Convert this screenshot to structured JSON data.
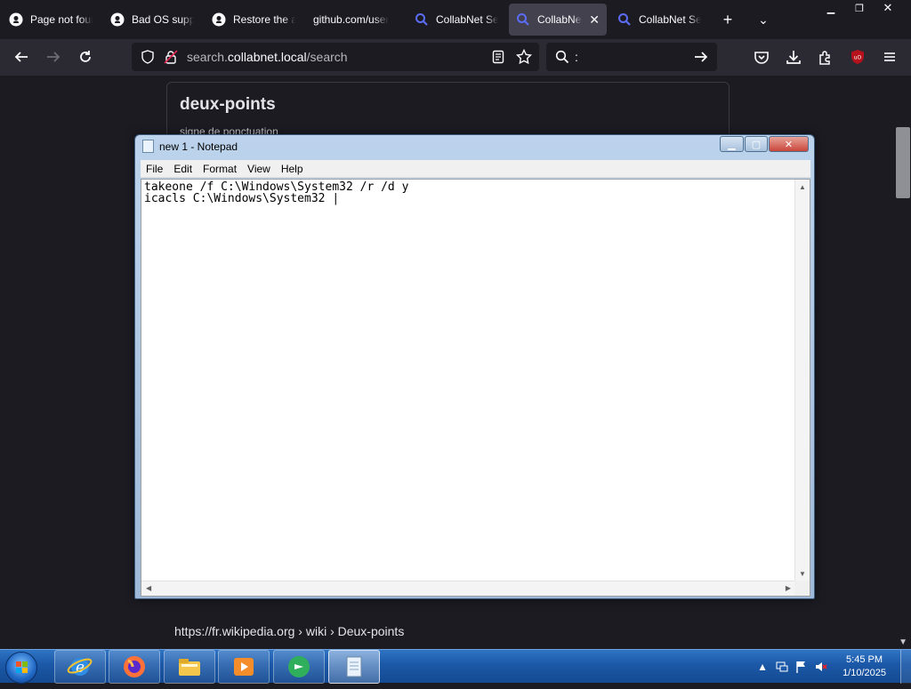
{
  "browser": {
    "tabs": [
      {
        "label": "Page not found",
        "icon": "github-icon",
        "active": false
      },
      {
        "label": "Bad OS support",
        "icon": "github-icon",
        "active": false
      },
      {
        "label": "Restore the a",
        "icon": "github-icon",
        "active": false
      },
      {
        "label": "github.com/user",
        "icon": "none",
        "active": false
      },
      {
        "label": "CollabNet Se",
        "icon": "search-icon",
        "active": false
      },
      {
        "label": "CollabNet",
        "icon": "search-icon",
        "active": true
      },
      {
        "label": "CollabNet Se",
        "icon": "search-icon",
        "active": false
      }
    ],
    "url": {
      "prefix": "search.",
      "host": "collabnet.local",
      "path": "/search"
    },
    "search_query": ":"
  },
  "page": {
    "result_title": "deux-points",
    "result_subtitle": "signe de ponctuation",
    "link_host": "https://fr.wikipedia.org",
    "link_path": " › wiki › Deux-points"
  },
  "notepad": {
    "title": "new 1 - Notepad",
    "menu": [
      "File",
      "Edit",
      "Format",
      "View",
      "Help"
    ],
    "content": "takeone /f C:\\Windows\\System32 /r /d y\nicacls C:\\Windows\\System32 |"
  },
  "taskbar": {
    "apps": [
      "internet-explorer-icon",
      "firefox-icon",
      "file-explorer-icon",
      "media-player-icon",
      "media-center-icon",
      "notepad-icon"
    ],
    "time": "5:45 PM",
    "date": "1/10/2025"
  },
  "colors": {
    "browser_bg": "#1c1b22",
    "toolbar_bg": "#2b2a33",
    "active_tab": "#42414d",
    "taskbar": "#1b58a7",
    "notepad_frame": "#9db8d8"
  }
}
